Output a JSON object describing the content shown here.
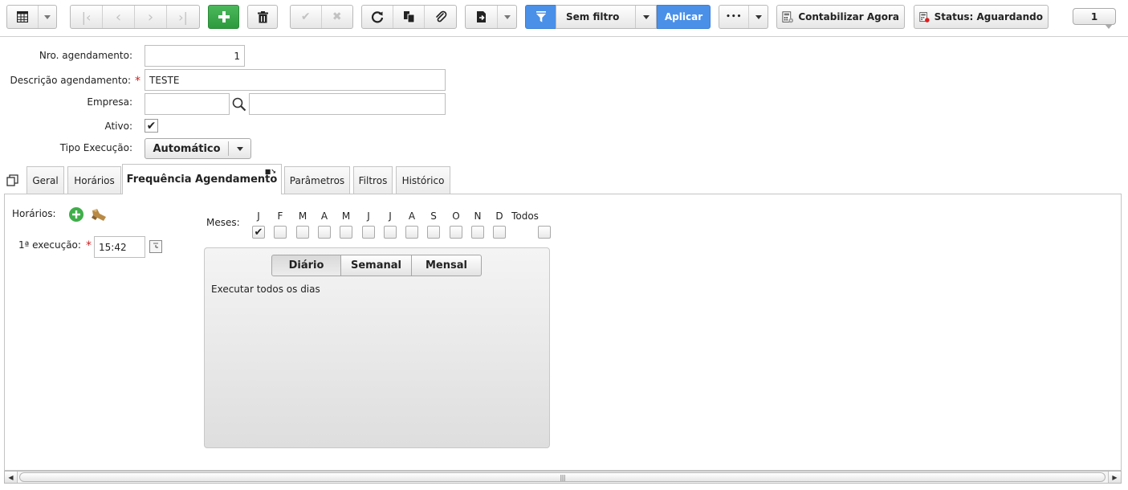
{
  "toolbar": {
    "filter_value": "Sem filtro",
    "apply_label": "Aplicar",
    "more_label": "•••",
    "contabilizar_label": "Contabilizar Agora",
    "status_label": "Status: Aguardando",
    "record_counter": "1"
  },
  "form": {
    "nro_label": "Nro. agendamento:",
    "nro_value": "1",
    "descricao_label": "Descrição agendamento:",
    "descricao_value": "TESTE",
    "empresa_label": "Empresa:",
    "empresa_code": "",
    "empresa_name": "",
    "ativo_label": "Ativo:",
    "ativo_checked": true,
    "tipo_label": "Tipo Execução:",
    "tipo_value": "Automático"
  },
  "tabs": [
    {
      "label": "Geral"
    },
    {
      "label": "Horários"
    },
    {
      "label": "Frequência Agendamento",
      "active": true
    },
    {
      "label": "Parâmetros"
    },
    {
      "label": "Filtros"
    },
    {
      "label": "Histórico"
    }
  ],
  "frequency": {
    "horarios_label": "Horários:",
    "primeira_label": "1ª execução:",
    "primeira_value": "15:42",
    "meses_label": "Meses:",
    "months": [
      {
        "label": "J",
        "checked": true
      },
      {
        "label": "F",
        "checked": false
      },
      {
        "label": "M",
        "checked": false
      },
      {
        "label": "A",
        "checked": false
      },
      {
        "label": "M",
        "checked": false
      },
      {
        "label": "J",
        "checked": false
      },
      {
        "label": "J",
        "checked": false
      },
      {
        "label": "A",
        "checked": false
      },
      {
        "label": "S",
        "checked": false
      },
      {
        "label": "O",
        "checked": false
      },
      {
        "label": "N",
        "checked": false
      },
      {
        "label": "D",
        "checked": false
      },
      {
        "label": "Todos",
        "checked": false
      }
    ],
    "modes": [
      {
        "label": "Diário",
        "active": true
      },
      {
        "label": "Semanal",
        "active": false
      },
      {
        "label": "Mensal",
        "active": false
      }
    ],
    "description": "Executar todos os dias"
  },
  "colors": {
    "accent_blue": "#4a90e8",
    "add_green": "#2e9a3e",
    "required_red": "#d02020"
  }
}
